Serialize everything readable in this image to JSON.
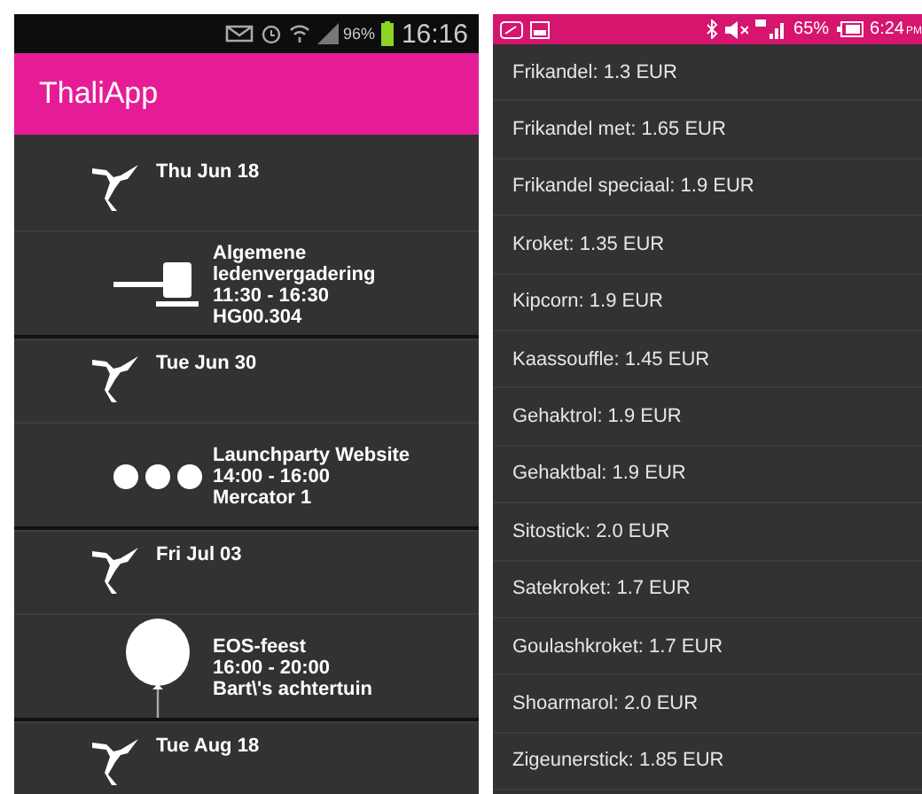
{
  "left_phone": {
    "status_bar": {
      "battery": "96%",
      "time": "16:16"
    },
    "app_bar": {
      "title": "ThaliApp"
    },
    "agenda": [
      {
        "kind": "day",
        "date": "Thu Jun 18"
      },
      {
        "kind": "meeting",
        "lines": [
          "Algemene",
          "ledenvergadering",
          "11:30 - 16:30",
          "HG00.304"
        ]
      },
      {
        "kind": "day",
        "date": "Tue Jun 30"
      },
      {
        "kind": "launch",
        "lines": [
          "Launchparty Website",
          "14:00 - 16:00",
          "Mercator 1"
        ]
      },
      {
        "kind": "day",
        "date": "Fri Jul 03"
      },
      {
        "kind": "party",
        "lines": [
          "EOS-feest",
          "16:00 - 20:00",
          "Bart\\'s achtertuin"
        ]
      },
      {
        "kind": "day",
        "date": "Tue Aug 18"
      }
    ]
  },
  "right_phone": {
    "status_bar": {
      "battery": "65%",
      "time": "6:24",
      "ampm": "PM"
    },
    "prices": [
      "Frikandel: 1.3 EUR",
      "Frikandel met: 1.65 EUR",
      "Frikandel speciaal: 1.9 EUR",
      "Kroket: 1.35 EUR",
      "Kipcorn: 1.9 EUR",
      "Kaassouffle: 1.45 EUR",
      "Gehaktrol: 1.9 EUR",
      "Gehaktbal: 1.9 EUR",
      "Sitostick: 2.0 EUR",
      "Satekroket: 1.7 EUR",
      "Goulashkroket: 1.7 EUR",
      "Shoarmarol: 2.0 EUR",
      "Zigeunerstick: 1.85 EUR"
    ]
  }
}
